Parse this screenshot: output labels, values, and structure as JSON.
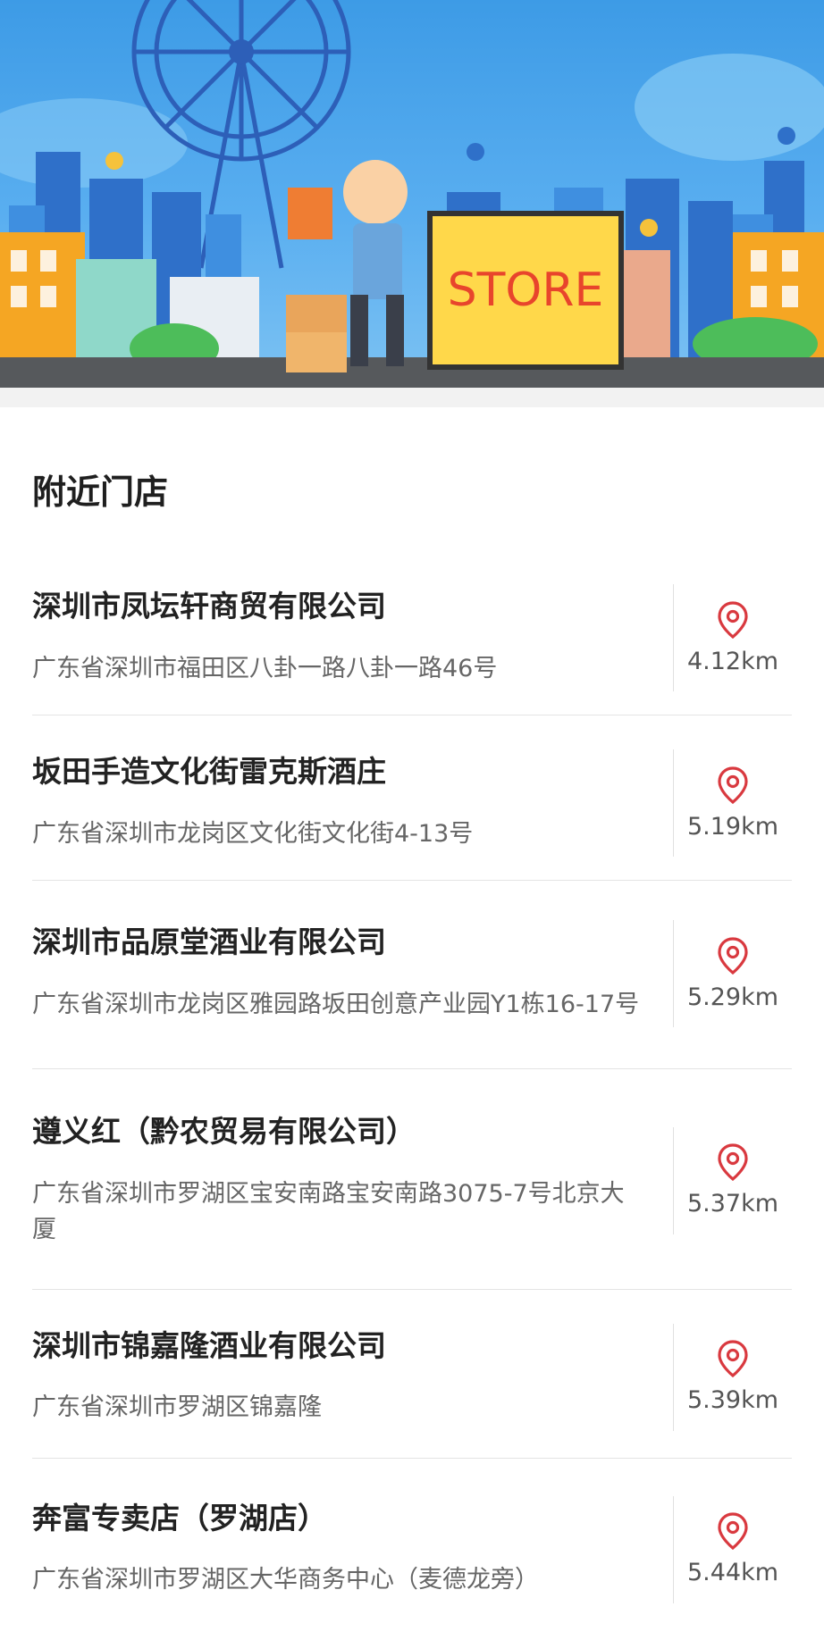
{
  "banner": {
    "sign_text": "STORE"
  },
  "section_title": "附近门店",
  "stores": [
    {
      "name": "深圳市凤坛轩商贸有限公司",
      "address": "广东省深圳市福田区八卦一路八卦一路46号",
      "distance": "4.12km"
    },
    {
      "name": "坂田手造文化街雷克斯酒庄",
      "address": "广东省深圳市龙岗区文化街文化街4-13号",
      "distance": "5.19km"
    },
    {
      "name": "深圳市品原堂酒业有限公司",
      "address": "广东省深圳市龙岗区雅园路坂田创意产业园Y1栋16-17号",
      "distance": "5.29km"
    },
    {
      "name": "遵义红（黔农贸易有限公司）",
      "address": "广东省深圳市罗湖区宝安南路宝安南路3075-7号北京大厦",
      "distance": "5.37km"
    },
    {
      "name": "深圳市锦嘉隆酒业有限公司",
      "address": "广东省深圳市罗湖区锦嘉隆",
      "distance": "5.39km"
    },
    {
      "name": "奔富专卖店（罗湖店）",
      "address": "广东省深圳市罗湖区大华商务中心（麦德龙旁）",
      "distance": "5.44km"
    }
  ],
  "colors": {
    "pin": "#d9393f",
    "banner_sky": "#4aa5ec",
    "sign": "#ffd84a",
    "sign_text": "#e8452c"
  }
}
